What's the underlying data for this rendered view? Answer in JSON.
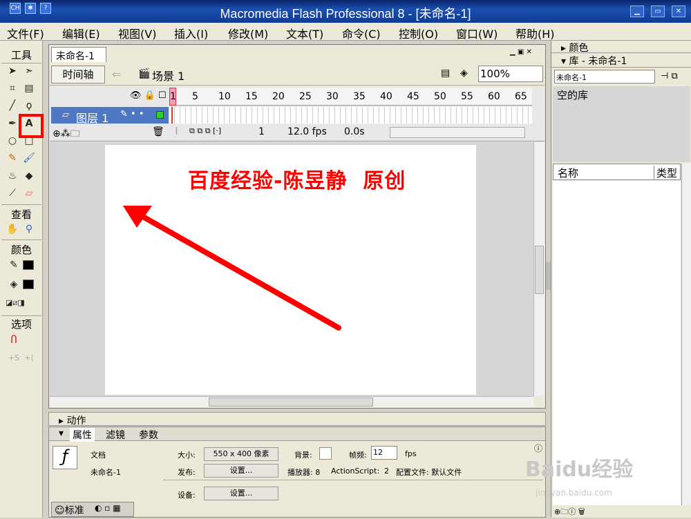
{
  "window": {
    "title": "Macromedia Flash Professional 8 - [未命名-1]",
    "lang": "CH"
  },
  "menu": [
    "文件(F)",
    "编辑(E)",
    "视图(V)",
    "插入(I)",
    "修改(M)",
    "文本(T)",
    "命令(C)",
    "控制(O)",
    "窗口(W)",
    "帮助(H)"
  ],
  "tools": {
    "header": "工具",
    "view_header": "查看",
    "color_header": "颜色",
    "options_header": "选项",
    "text_tool": "A"
  },
  "doc": {
    "tab": "未命名-1",
    "timeline_button": "时间轴",
    "scene": "场景 1",
    "zoom": "100%"
  },
  "timeline": {
    "ruler": [
      "1",
      "5",
      "10",
      "15",
      "20",
      "25",
      "30",
      "35",
      "40",
      "45",
      "50",
      "55",
      "60",
      "65"
    ],
    "layer": "图层 1",
    "frame": "1",
    "fps": "12.0 fps",
    "time": "0.0s"
  },
  "stage": {
    "text": "百度经验-陈昱静  原创"
  },
  "right": {
    "color_panel": "颜色",
    "library_panel": "库 - 未命名-1",
    "library_select": "未命名-1",
    "empty": "空的库",
    "col_name": "名称",
    "col_type": "类型"
  },
  "actions": {
    "label": "动作"
  },
  "props": {
    "tab_props": "属性",
    "tab_filters": "滤镜",
    "tab_params": "参数",
    "doc_label": "文档",
    "doc_name": "未命名-1",
    "size_label": "大小:",
    "size_value": "550 x 400 像素",
    "bg_label": "背景:",
    "fps_label": "帧频:",
    "fps_value": "12",
    "fps_unit": "fps",
    "publish_label": "发布:",
    "settings1": "设置...",
    "player_label": "播放器: 8",
    "as_label": "ActionScript:  2",
    "profile_label": "配置文件: 默认文件",
    "device_label": "设备:",
    "settings2": "设置...",
    "std_tab": "标准"
  },
  "watermark": {
    "main": "Baidu经验",
    "sub": "jingyan.baidu.com"
  },
  "colors": {
    "annotation": "#ff0000",
    "title_bar": "#0a246a"
  }
}
